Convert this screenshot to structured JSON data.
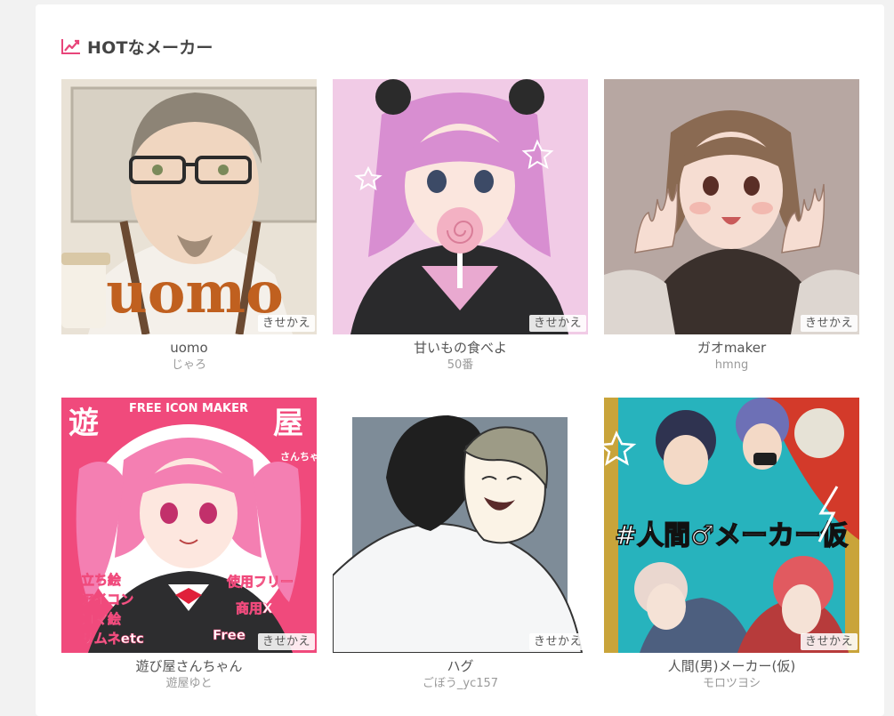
{
  "section": {
    "title": "HOTなメーカー",
    "icon": "trending-up-icon",
    "accent_color": "#e8457a"
  },
  "makers": [
    {
      "name": "uomo",
      "author": "じゃろ",
      "badge": "きせかえ",
      "art_text": "uomo"
    },
    {
      "name": "甘いもの食べよ",
      "author": "50番",
      "badge": "きせかえ"
    },
    {
      "name": "ガオmaker",
      "author": "hmng",
      "badge": "きせかえ"
    },
    {
      "name": "遊び屋さんちゃん",
      "author": "遊屋ゆと",
      "badge": "きせかえ",
      "art_text": {
        "banner": "FREE ICON MAKER",
        "left_kanji": "遊",
        "right_kanji": "屋",
        "right_sub": "さんちゃん",
        "list_left": [
          "立ち絵",
          "アイコン",
          "コマ絵",
          "サムネetc"
        ],
        "list_right": [
          "使用フリー",
          "商用X",
          "Free"
        ]
      }
    },
    {
      "name": "ハグ",
      "author": "ごぼう_yc157",
      "badge": "きせかえ"
    },
    {
      "name": "人間(男)メーカー(仮)",
      "author": "モロツヨシ",
      "badge": "きせかえ",
      "art_text": "#人間♂メーカー仮"
    }
  ]
}
